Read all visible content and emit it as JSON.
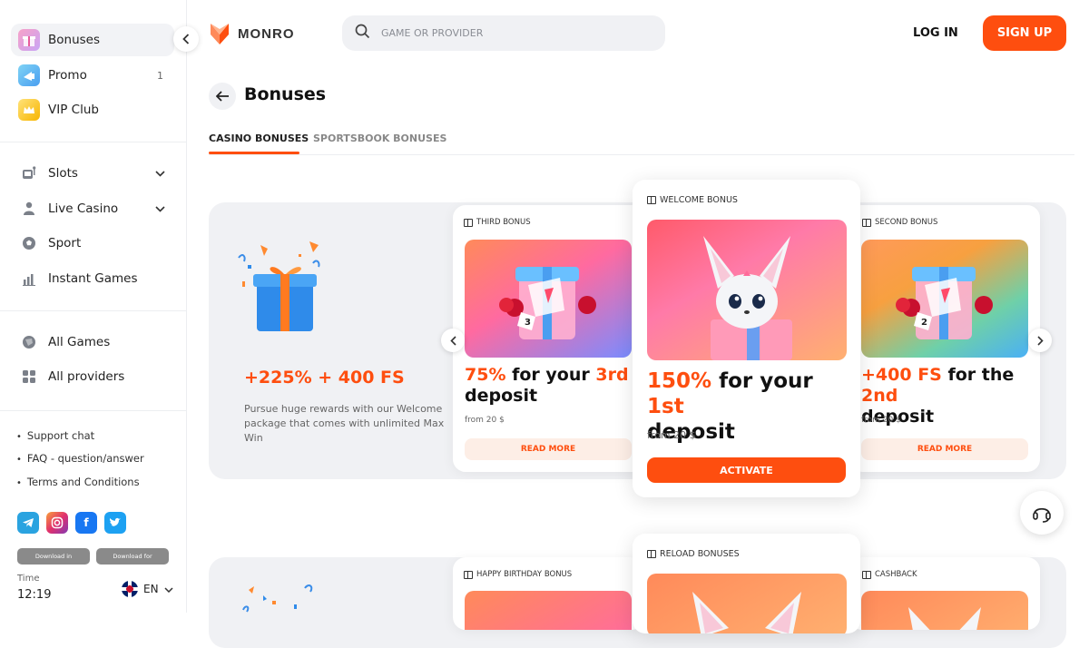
{
  "sidebar": {
    "top_items": [
      {
        "label": "Bonuses",
        "icon": "gift-icon"
      },
      {
        "label": "Promo",
        "icon": "promo-icon",
        "badge": "1"
      },
      {
        "label": "VIP Club",
        "icon": "crown-icon"
      }
    ],
    "game_items": [
      {
        "label": "Slots",
        "icon": "slot-machine-icon"
      },
      {
        "label": "Live Casino",
        "icon": "dealer-icon"
      },
      {
        "label": "Sport",
        "icon": "soccer-ball-icon"
      },
      {
        "label": "Instant Games",
        "icon": "bar-chart-icon"
      }
    ],
    "catalog_items": [
      {
        "label": "All Games",
        "icon": "globe-icon"
      },
      {
        "label": "All providers",
        "icon": "grid-icon"
      }
    ],
    "footer_links": [
      "Support chat",
      "FAQ - question/answer",
      "Terms and Conditions"
    ],
    "social": [
      {
        "name": "telegram",
        "color": "#2aa3e0"
      },
      {
        "name": "instagram",
        "color": "#e1306c"
      },
      {
        "name": "facebook",
        "color": "#1877f2"
      },
      {
        "name": "twitter",
        "color": "#1da1f2"
      }
    ],
    "store_buttons": [
      "Download in",
      "Download for"
    ],
    "time_label": "Time",
    "time_value": "12:19",
    "language": "EN"
  },
  "header": {
    "logo_text": "MONRO",
    "search_placeholder": "GAME OR PROVIDER",
    "login_label": "LOG IN",
    "signup_label": "SIGN UP",
    "accent_color": "#fe4e0f"
  },
  "page": {
    "title": "Bonuses",
    "tabs": [
      "CASINO BONUSES",
      "SPORTSBOOK BONUSES"
    ]
  },
  "promo": {
    "title": "+225% + 400 FS",
    "description": "Pursue huge rewards with our Welcome package that comes with unlimited Max Win"
  },
  "cards": {
    "third": {
      "label": "THIRD BONUS",
      "title_hl1": "75%",
      "title_mid": " for your ",
      "title_hl2": "3rd",
      "title_end": "deposit",
      "from": "from 20 $",
      "button": "READ MORE"
    },
    "welcome": {
      "label": "WELCOME BONUS",
      "title_hl1": "150%",
      "title_mid": " for your ",
      "title_hl2": "1st",
      "title_end": "deposit",
      "from": "from  20 $",
      "button": "ACTIVATE"
    },
    "second": {
      "label": "SECOND BONUS",
      "title_hl1": "+400 FS",
      "title_mid": " for the ",
      "title_hl2": "2nd",
      "title_end": "deposit",
      "from": "from 20 $",
      "button": "READ MORE"
    }
  },
  "lower_cards": [
    "HAPPY BIRTHDAY BONUS",
    "RELOAD BONUSES",
    "CASHBACK"
  ]
}
